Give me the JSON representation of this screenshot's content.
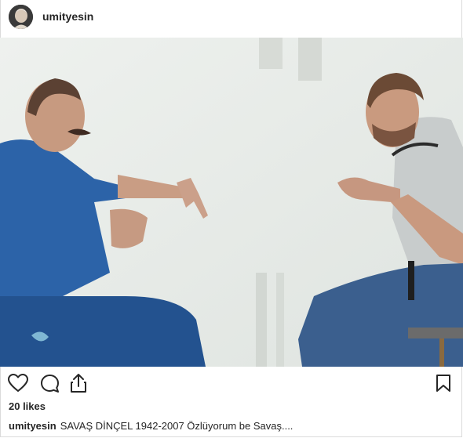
{
  "post": {
    "username": "umityesin",
    "likes": "20 likes",
    "caption_user": "umityesin",
    "caption_text": "SAVAŞ DİNÇEL 1942-2007 Özlüyorum be Savaş...."
  },
  "icons": {
    "like": "heart-icon",
    "comment": "comment-icon",
    "share": "share-icon",
    "save": "bookmark-icon"
  },
  "colors": {
    "text": "#262626",
    "border": "#dbdbdb",
    "jacket": "#2c63a8",
    "jeans": "#3b5f8e"
  }
}
